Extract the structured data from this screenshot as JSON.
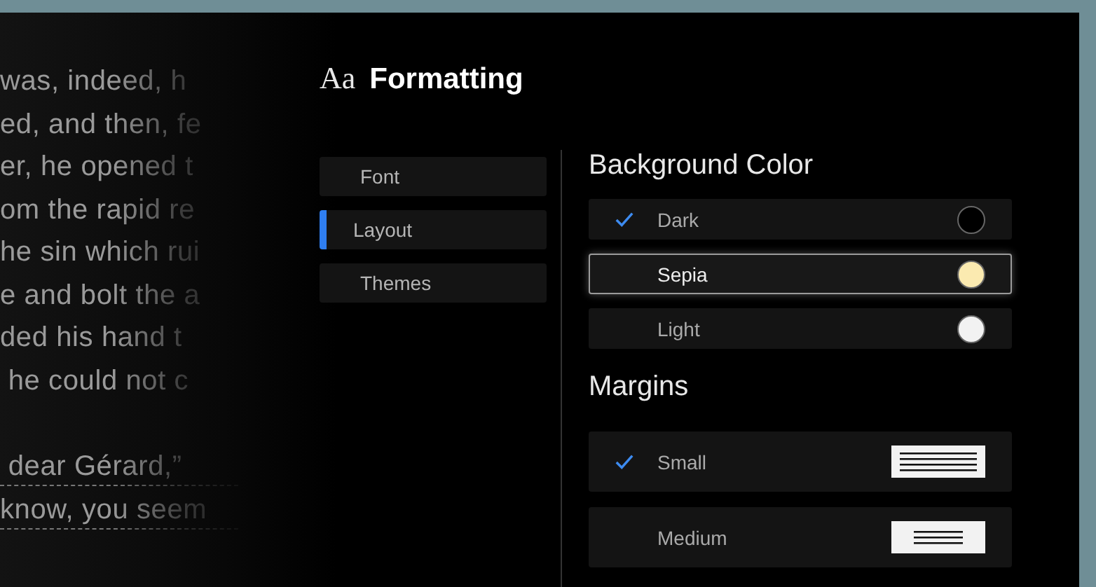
{
  "book": {
    "lines": [
      {
        "text": "was, indeed, h",
        "underlined": false,
        "new_paragraph": false
      },
      {
        "text": "ed, and then, fe",
        "underlined": false,
        "new_paragraph": false
      },
      {
        "text": "er, he opened t",
        "underlined": false,
        "new_paragraph": false
      },
      {
        "text": "om the rapid re",
        "underlined": false,
        "new_paragraph": false
      },
      {
        "text": "he sin which rui",
        "underlined": false,
        "new_paragraph": false
      },
      {
        "text": "e and bolt the a",
        "underlined": false,
        "new_paragraph": false
      },
      {
        "text": "ded his hand t",
        "underlined": false,
        "new_paragraph": false
      },
      {
        "text": " he could not c",
        "underlined": false,
        "new_paragraph": false
      },
      {
        "text": " dear Gérard,”",
        "underlined": true,
        "new_paragraph": true
      },
      {
        "text": "know, you seem",
        "underlined": true,
        "new_paragraph": false
      }
    ]
  },
  "panel": {
    "title": "Formatting",
    "title_icon": "Aa",
    "tabs": [
      {
        "label": "Font",
        "selected": false
      },
      {
        "label": "Layout",
        "selected": true
      },
      {
        "label": "Themes",
        "selected": false
      }
    ],
    "sections": [
      {
        "heading": "Background Color",
        "kind": "color",
        "options": [
          {
            "label": "Dark",
            "checked": true,
            "focused": false,
            "color": "#000000"
          },
          {
            "label": "Sepia",
            "checked": false,
            "focused": true,
            "color": "#fbeab0"
          },
          {
            "label": "Light",
            "checked": false,
            "focused": false,
            "color": "#f2f2f2"
          }
        ]
      },
      {
        "heading": "Margins",
        "kind": "margin",
        "options": [
          {
            "label": "Small",
            "checked": true,
            "focused": false,
            "kind": "narrow"
          },
          {
            "label": "Medium",
            "checked": false,
            "focused": false,
            "kind": "wide"
          }
        ]
      }
    ]
  }
}
